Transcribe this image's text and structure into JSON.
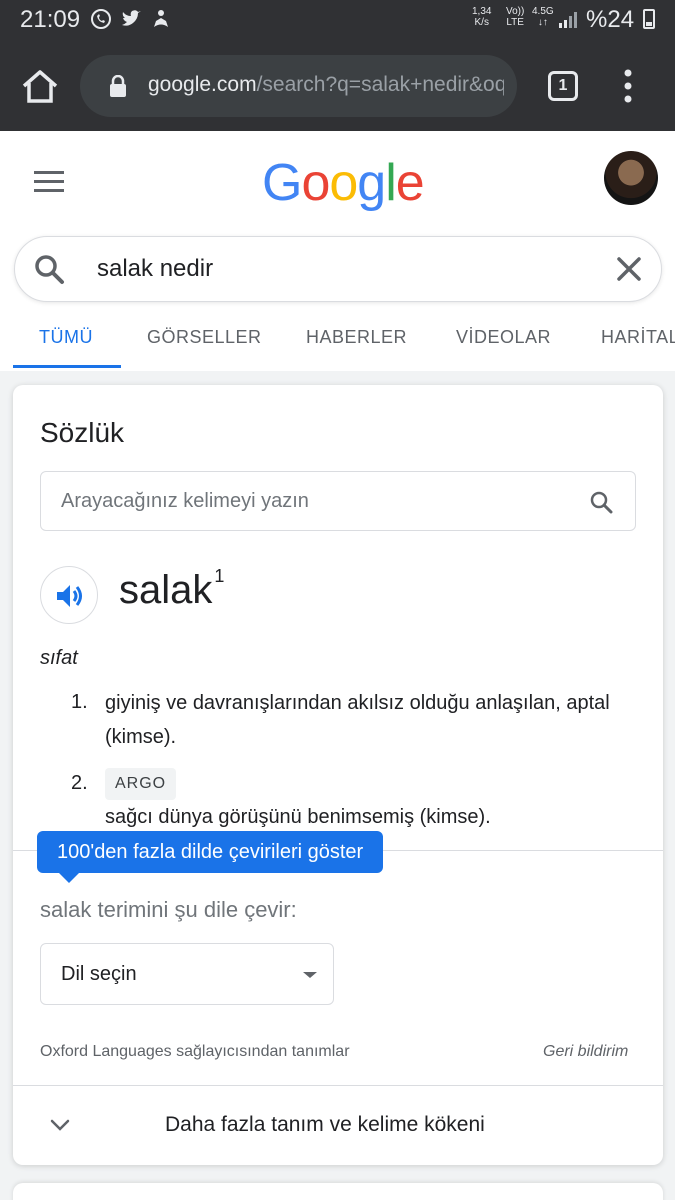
{
  "status_bar": {
    "time": "21:09",
    "net_speed_value": "1,34",
    "net_speed_unit": "K/s",
    "volte_top": "Vo))",
    "volte_bottom": "LTE",
    "network": "4.5G",
    "battery_text": "%24",
    "notification_icons": [
      "whatsapp-icon",
      "twitter-icon",
      "yoga-app-icon"
    ]
  },
  "browser": {
    "url_domain": "google.com",
    "url_rest": "/search?q=salak+nedir&oq",
    "tab_count": "1"
  },
  "google": {
    "search_query": "salak nedir",
    "tabs": [
      {
        "label": "TÜMÜ",
        "active": true
      },
      {
        "label": "GÖRSELLER",
        "active": false
      },
      {
        "label": "HABERLER",
        "active": false
      },
      {
        "label": "VİDEOLAR",
        "active": false
      },
      {
        "label": "HARİTALAR",
        "active": false
      }
    ],
    "accent_color": "#1a73e8"
  },
  "dictionary": {
    "title": "Sözlük",
    "search_placeholder": "Arayacağınız kelimeyi yazın",
    "word": "salak",
    "superscript": "1",
    "part_of_speech": "sıfat",
    "definitions": [
      {
        "num": "1.",
        "text": "giyiniş ve davranışlarından akılsız olduğu anlaşılan, aptal (kimse)."
      },
      {
        "num": "2.",
        "label": "ARGO",
        "text": "sağcı dünya görüşünü benimsemiş (kimse)."
      }
    ],
    "tooltip": "100'den fazla dilde çevirileri göster",
    "translate_label": "salak terimini şu dile çevir:",
    "language_select": "Dil seçin",
    "source": "Oxford Languages sağlayıcısından tanımlar",
    "feedback": "Geri bildirim",
    "more_label": "Daha fazla tanım ve kelime kökeni"
  }
}
